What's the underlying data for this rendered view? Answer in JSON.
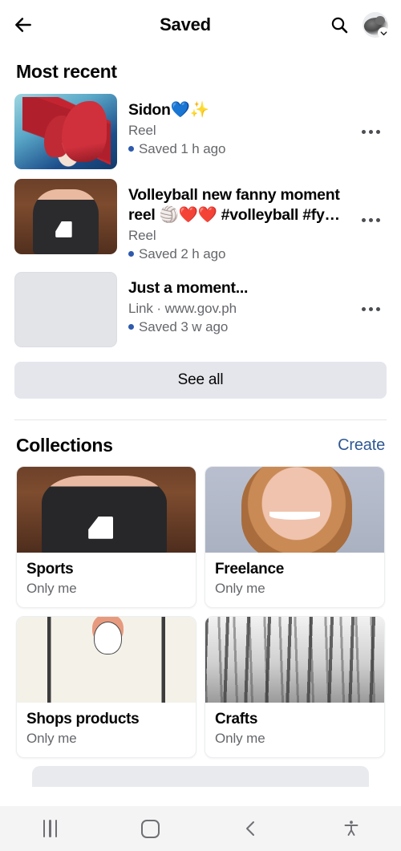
{
  "header": {
    "back_icon": "arrow-left-icon",
    "title": "Saved",
    "search_icon": "search-icon",
    "avatar_icon": "avatar",
    "avatar_badge_icon": "chevron-down-icon"
  },
  "most_recent": {
    "title": "Most recent",
    "items": [
      {
        "title": "Sidon💙✨",
        "subtitle": "Reel",
        "meta": "Saved 1 h ago",
        "thumb_class": "t1",
        "menu_icon": "more-options-icon"
      },
      {
        "title": "Volleyball new fanny moment reel 🏐❤️❤️ #volleyball #fy…",
        "subtitle": "Reel",
        "meta": "Saved 2 h ago",
        "thumb_class": "t2",
        "menu_icon": "more-options-icon"
      },
      {
        "title": "Just a moment...",
        "subtitle": "Link · www.gov.ph",
        "meta": "Saved 3 w ago",
        "thumb_class": "placeholder",
        "menu_icon": "more-options-icon"
      }
    ],
    "see_all_label": "See all"
  },
  "collections": {
    "title": "Collections",
    "create_label": "Create",
    "cards": [
      {
        "title": "Sports",
        "privacy": "Only me",
        "img_class": "ci-sports"
      },
      {
        "title": "Freelance",
        "privacy": "Only me",
        "img_class": "ci-freelance"
      },
      {
        "title": "Shops products",
        "privacy": "Only me",
        "img_class": "ci-shops"
      },
      {
        "title": "Crafts",
        "privacy": "Only me",
        "img_class": "ci-crafts"
      }
    ]
  },
  "navbar": {
    "recents_icon": "recent-apps-icon",
    "home_icon": "home-icon",
    "back_icon": "back-icon",
    "accessibility_icon": "accessibility-icon"
  },
  "colors": {
    "accent_blue": "#2e5aac",
    "link_blue": "#2f5893",
    "text_primary": "#050505",
    "text_secondary": "#65676b",
    "button_gray": "#e4e6eb",
    "navbar_gray": "#f4f4f5"
  }
}
